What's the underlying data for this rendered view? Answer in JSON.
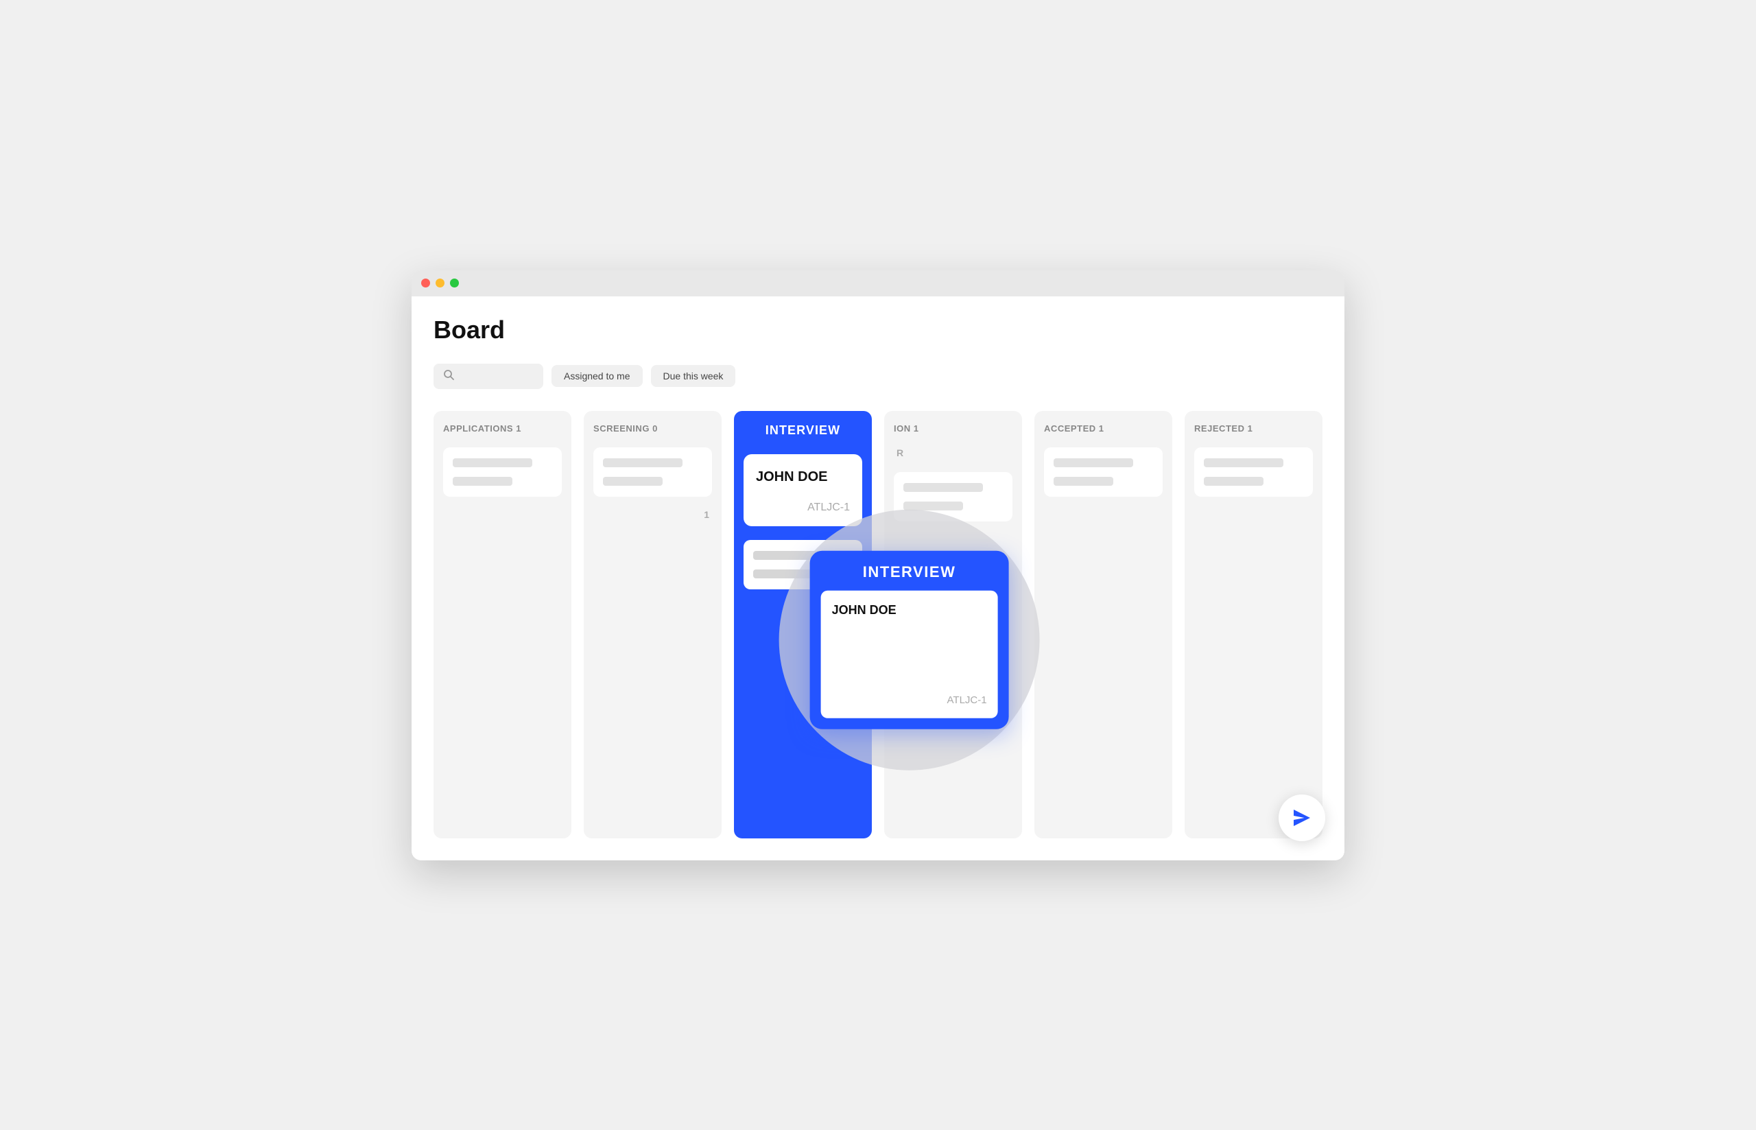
{
  "window": {
    "title": "Board"
  },
  "page": {
    "title": "Board"
  },
  "toolbar": {
    "search_placeholder": "Search",
    "filter1_label": "Assigned to me",
    "filter2_label": "Due this week"
  },
  "columns": [
    {
      "id": "applications",
      "header": "APPLICATIONS 1",
      "interview": false
    },
    {
      "id": "screening",
      "header": "SCREENING 0",
      "interview": false
    },
    {
      "id": "interview",
      "header": "INTERVIEW",
      "interview": true
    },
    {
      "id": "offer",
      "header": "ION 1",
      "interview": false
    },
    {
      "id": "accepted",
      "header": "ACCEPTED 1",
      "interview": false
    },
    {
      "id": "rejected",
      "header": "REJECTED 1",
      "interview": false
    }
  ],
  "magnifier": {
    "header": "INTERVIEW",
    "card": {
      "name": "JOHN DOE",
      "id": "ATLJC-1"
    }
  },
  "screening_partial": "1",
  "offer_partial": "R",
  "fab": {
    "label": "Send message"
  }
}
